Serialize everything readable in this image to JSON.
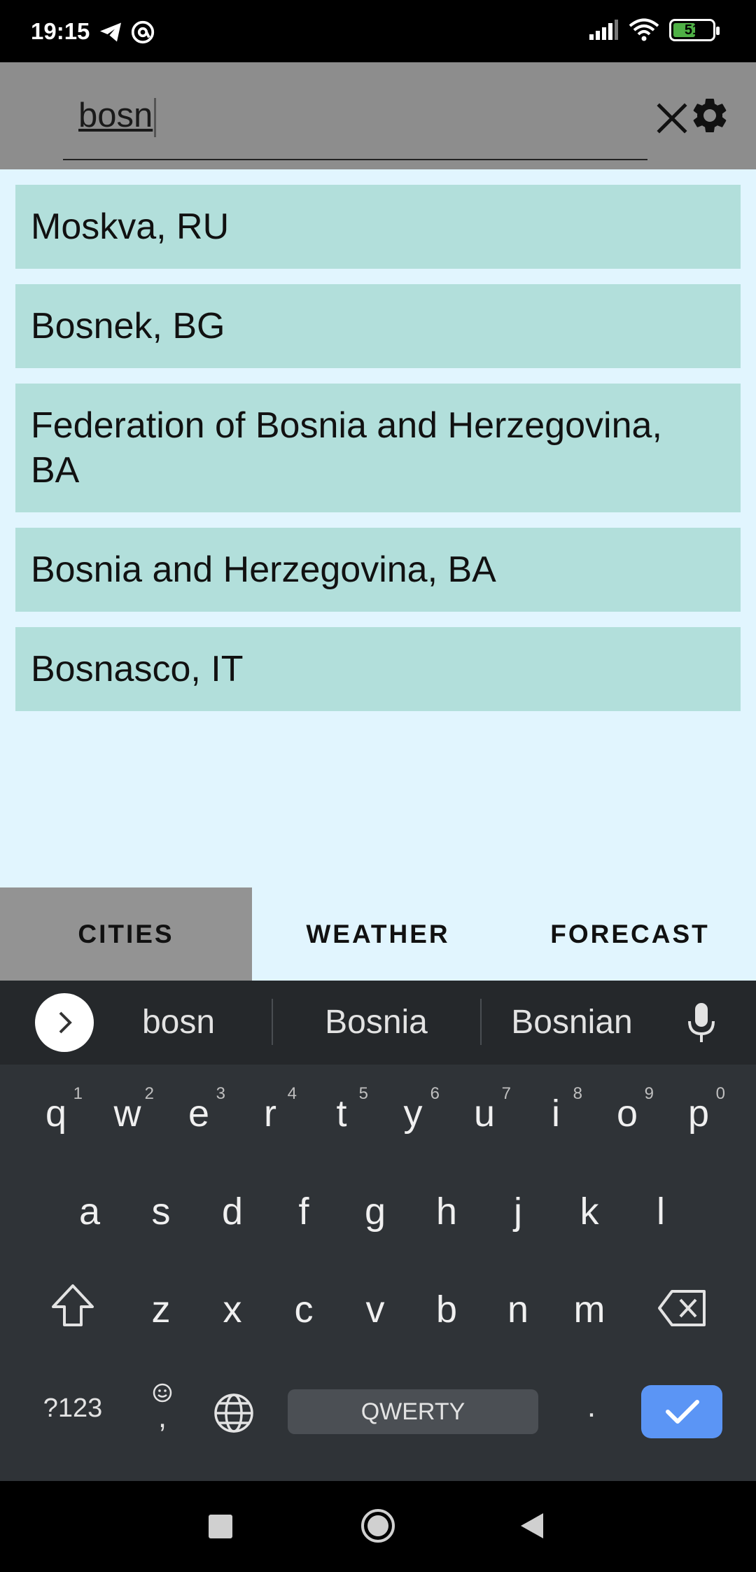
{
  "status_bar": {
    "time": "19:15",
    "battery_level": "51",
    "icons": [
      "telegram-icon",
      "at-sign-icon",
      "signal-icon",
      "wifi-icon",
      "battery-icon"
    ]
  },
  "search": {
    "value": "bosn",
    "clear_icon": "close-icon",
    "settings_icon": "gear-icon"
  },
  "cities": [
    {
      "label": "Moskva, RU"
    },
    {
      "label": "Bosnek, BG"
    },
    {
      "label": "Federation of Bosnia and Herzegovina, BA"
    },
    {
      "label": "Bosnia and Herzegovina, BA"
    },
    {
      "label": "Bosnasco, IT"
    }
  ],
  "tabs": [
    {
      "label": "CITIES",
      "active": true
    },
    {
      "label": "WEATHER",
      "active": false
    },
    {
      "label": "FORECAST",
      "active": false
    }
  ],
  "keyboard": {
    "suggestions": [
      "bosn",
      "Bosnia",
      "Bosnian"
    ],
    "row1": [
      {
        "k": "q",
        "h": "1"
      },
      {
        "k": "w",
        "h": "2"
      },
      {
        "k": "e",
        "h": "3"
      },
      {
        "k": "r",
        "h": "4"
      },
      {
        "k": "t",
        "h": "5"
      },
      {
        "k": "y",
        "h": "6"
      },
      {
        "k": "u",
        "h": "7"
      },
      {
        "k": "i",
        "h": "8"
      },
      {
        "k": "o",
        "h": "9"
      },
      {
        "k": "p",
        "h": "0"
      }
    ],
    "row2": [
      "a",
      "s",
      "d",
      "f",
      "g",
      "h",
      "j",
      "k",
      "l"
    ],
    "row3": [
      "z",
      "x",
      "c",
      "v",
      "b",
      "n",
      "m"
    ],
    "symbols_label": "?123",
    "comma_label": ",",
    "space_label": "QWERTY",
    "period_label": "."
  },
  "colors": {
    "header_bg": "#8d8d8d",
    "content_bg": "#e1f5fe",
    "item_bg": "#b2dfdb",
    "tab_active_bg": "#939393",
    "keyboard_bg": "#2f3337",
    "enter_key": "#5b95f5"
  }
}
